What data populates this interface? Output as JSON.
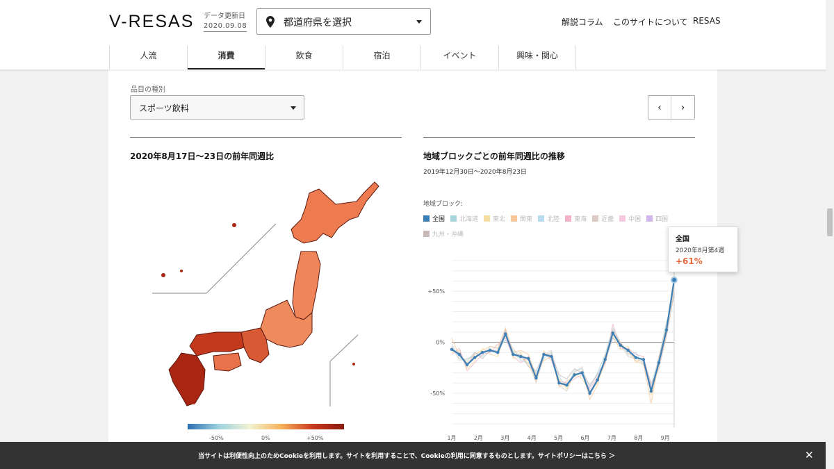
{
  "header": {
    "logo": "V-RESAS",
    "update_label": "データ更新日",
    "update_date": "2020.09.08",
    "prefecture_select": "都道府県を選択",
    "links": [
      "解説コラム",
      "このサイトについて",
      "RESAS"
    ],
    "tabs": [
      {
        "label": "人流",
        "active": false
      },
      {
        "label": "消費",
        "active": true
      },
      {
        "label": "飲食",
        "active": false
      },
      {
        "label": "宿泊",
        "active": false
      },
      {
        "label": "イベント",
        "active": false
      },
      {
        "label": "興味・関心",
        "active": false
      }
    ]
  },
  "filter": {
    "label": "品目の種別",
    "value": "スポーツ飲料",
    "prev": "‹",
    "next": "›"
  },
  "map_section": {
    "title": "2020年8月17日〜23日の前年同週比",
    "scale_labels": [
      "-50%",
      "0%",
      "+50%"
    ]
  },
  "chart_section": {
    "title": "地域ブロックごとの前年同週比の推移",
    "subtitle": "2019年12月30日〜2020年8月23日",
    "legend_label": "地域ブロック:",
    "legend": [
      {
        "name": "全国",
        "color": "#3b7fb6",
        "on": true
      },
      {
        "name": "北海道",
        "color": "#a8d4dc",
        "on": false
      },
      {
        "name": "東北",
        "color": "#f7dca0",
        "on": false
      },
      {
        "name": "関東",
        "color": "#f5c79a",
        "on": false
      },
      {
        "name": "北陸",
        "color": "#b7dcf0",
        "on": false
      },
      {
        "name": "東海",
        "color": "#f2b3c6",
        "on": false
      },
      {
        "name": "近畿",
        "color": "#dbcbc2",
        "on": false
      },
      {
        "name": "中国",
        "color": "#f7c8e2",
        "on": false
      },
      {
        "name": "四国",
        "color": "#d1b6ee",
        "on": false
      },
      {
        "name": "九州・沖縄",
        "color": "#c9b9b9",
        "on": false
      }
    ],
    "tooltip": {
      "region": "全国",
      "week": "2020年8月第4週",
      "value": "+61%"
    }
  },
  "cookie_bar": {
    "message": "当サイトは利便性向上のためCookieを利用します。サイトを利用することで、Cookieの利用に同意するものとします。サイトポリシーはこちら ＞",
    "close": "✕"
  },
  "chart_data": {
    "type": "line",
    "x_ticks": [
      "1月",
      "2月",
      "3月",
      "4月",
      "5月",
      "6月",
      "7月",
      "8月",
      "9月"
    ],
    "y_ticks": [
      "+50%",
      "0%",
      "-50%"
    ],
    "ylim": [
      -80,
      80
    ],
    "series": [
      {
        "name": "全国",
        "values": [
          -7,
          -12,
          -22,
          -15,
          -10,
          -8,
          -10,
          8,
          -12,
          -14,
          -16,
          -35,
          -12,
          -14,
          -40,
          -42,
          -32,
          -30,
          -50,
          -37,
          -17,
          9,
          -3,
          -8,
          -15,
          -17,
          -48,
          -20,
          12,
          61
        ]
      },
      {
        "name": "北海道",
        "values": [
          -2,
          -16,
          -18,
          -10,
          -14,
          -4,
          -6,
          2,
          -8,
          -18,
          -20,
          -30,
          -16,
          -10,
          -34,
          -44,
          -28,
          -26,
          -44,
          -30,
          -12,
          14,
          0,
          -12,
          -10,
          -22,
          -42,
          -16,
          20,
          46
        ]
      },
      {
        "name": "東北",
        "values": [
          -10,
          -8,
          -26,
          -18,
          -6,
          -12,
          -14,
          10,
          -16,
          -10,
          -22,
          -38,
          -8,
          -18,
          -36,
          -46,
          -30,
          -36,
          -48,
          -40,
          -20,
          6,
          -8,
          -4,
          -20,
          -14,
          -52,
          -24,
          8,
          55
        ]
      },
      {
        "name": "関東",
        "values": [
          4,
          -14,
          -20,
          -12,
          -8,
          -4,
          -6,
          14,
          -10,
          -8,
          -12,
          -32,
          -18,
          -14,
          -44,
          -38,
          -34,
          -28,
          -56,
          -42,
          -14,
          10,
          0,
          -10,
          -18,
          -22,
          -60,
          -18,
          16,
          62
        ]
      },
      {
        "name": "東海",
        "values": [
          -12,
          -6,
          -28,
          -20,
          -12,
          -10,
          -2,
          4,
          -14,
          -20,
          -14,
          -36,
          -10,
          -18,
          -38,
          -40,
          -36,
          -32,
          -46,
          -34,
          -22,
          18,
          -6,
          -6,
          -12,
          -14,
          -44,
          -22,
          10,
          58
        ]
      },
      {
        "name": "近畿",
        "values": [
          -4,
          -18,
          -16,
          -14,
          -10,
          -6,
          -12,
          6,
          -6,
          -16,
          -18,
          -40,
          -14,
          -8,
          -42,
          -48,
          -30,
          -24,
          -52,
          -38,
          -16,
          12,
          -2,
          -14,
          -16,
          -20,
          -50,
          -14,
          14,
          50
        ]
      },
      {
        "name": "九州・沖縄",
        "values": [
          -8,
          -10,
          -24,
          -10,
          -16,
          -8,
          -8,
          12,
          -12,
          -12,
          -24,
          -28,
          -12,
          -12,
          -32,
          -36,
          -26,
          -30,
          -42,
          -32,
          -18,
          4,
          -4,
          -8,
          -14,
          -18,
          -40,
          -26,
          6,
          48
        ]
      }
    ]
  }
}
